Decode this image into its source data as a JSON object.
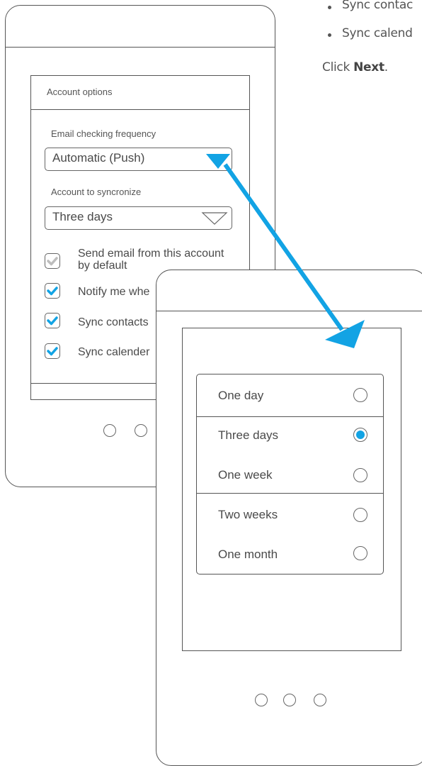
{
  "instructions": {
    "bullets": [
      "Sync contac",
      "Sync calend"
    ],
    "click_prefix": "Click ",
    "click_bold": "Next",
    "click_suffix": "."
  },
  "colors": {
    "accent": "#12a3e4",
    "outline": "#555555",
    "muted_check": "#bdbdbd"
  },
  "account_screen": {
    "panel_title": "Account options",
    "frequency_label": "Email checking frequency",
    "frequency_value": "Automatic (Push)",
    "sync_label": "Account to syncronize",
    "sync_value": "Three days",
    "checkboxes": [
      {
        "line1": "Send email from this account",
        "line2": "by default",
        "checked": false
      },
      {
        "line1": "Notify me whe",
        "checked": true
      },
      {
        "line1": "Sync contacts",
        "checked": true
      },
      {
        "line1": "Sync calender",
        "checked": true
      }
    ]
  },
  "picker_screen": {
    "options": [
      {
        "label": "One day",
        "selected": false
      },
      {
        "label": "Three days",
        "selected": true
      },
      {
        "label": "One week",
        "selected": false
      },
      {
        "label": "Two weeks",
        "selected": false
      },
      {
        "label": "One month",
        "selected": false
      }
    ]
  }
}
